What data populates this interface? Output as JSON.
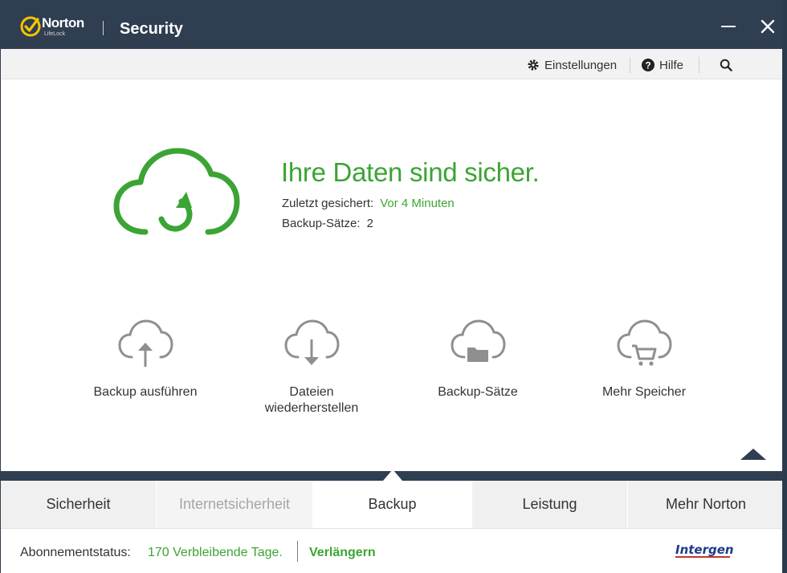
{
  "titlebar": {
    "brand": "Norton",
    "brand_sub": "LifeLock",
    "app_title": "Security"
  },
  "toolbar": {
    "settings_label": "Einstellungen",
    "help_label": "Hilfe"
  },
  "hero": {
    "title": "Ihre Daten sind sicher.",
    "last_backup_label": "Zuletzt gesichert:",
    "last_backup_value": "Vor 4 Minuten",
    "backup_sets_label": "Backup-Sätze:",
    "backup_sets_value": "2"
  },
  "actions": [
    {
      "label": "Backup ausführen",
      "icon": "cloud-upload-icon"
    },
    {
      "label": "Dateien wiederherstellen",
      "icon": "cloud-download-icon"
    },
    {
      "label": "Backup-Sätze",
      "icon": "cloud-folder-icon"
    },
    {
      "label": "Mehr Speicher",
      "icon": "cloud-cart-icon"
    }
  ],
  "tabs": [
    {
      "label": "Sicherheit",
      "state": "normal"
    },
    {
      "label": "Internetsicherheit",
      "state": "disabled"
    },
    {
      "label": "Backup",
      "state": "active"
    },
    {
      "label": "Leistung",
      "state": "normal"
    },
    {
      "label": "Mehr Norton",
      "state": "normal"
    }
  ],
  "status": {
    "label": "Abonnementstatus:",
    "value": "170 Verbleibende Tage.",
    "renew": "Verlängern"
  },
  "watermark": {
    "text": "Intergend"
  },
  "colors": {
    "accent_green": "#3ca434",
    "titlebar": "#2f3e51",
    "text": "#333333"
  }
}
